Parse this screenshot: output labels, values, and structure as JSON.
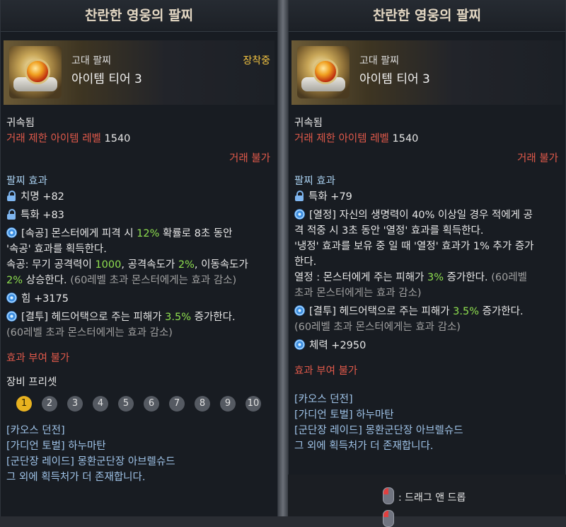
{
  "left": {
    "title": "찬란한 영웅의 팔찌",
    "grade": "고대 팔찌",
    "tier": "아이템 티어 3",
    "equipped": "장착중",
    "bound": "귀속됨",
    "level_label": "거래 제한 아이템 레벨",
    "level_value": "1540",
    "trade": "거래 불가",
    "effect_header": "팔찌 효과",
    "stat1": "치명 +82",
    "stat2": "특화 +83",
    "e1a": "[속공] 몬스터에게 피격 시 ",
    "e1b": "12%",
    "e1c": " 확률로 8초 동안",
    "e1d": "'속공' 효과를 획득한다.",
    "e2a": "속공: 무기 공격력이 ",
    "e2b": "1000",
    "e2c": ", 공격속도가 ",
    "e2d": "2%",
    "e2e": ", 이동속도가",
    "e2f": "2%",
    "e2g": " 상승한다. ",
    "e2h": "(60레벨 초과 몬스터에게는 효과 감소)",
    "stat3": "힘 +3175",
    "e3a": "[결투] 헤드어택으로 주는 피해가 ",
    "e3b": "3.5%",
    "e3c": " 증가한다.",
    "e3d": "(60레벨 초과 몬스터에게는 효과 감소)",
    "no_grant": "효과 부여 불가",
    "preset_label": "장비 프리셋",
    "presets": [
      "1",
      "2",
      "3",
      "4",
      "5",
      "6",
      "7",
      "8",
      "9",
      "10"
    ],
    "src1": "[카오스 던전]",
    "src2": "[가디언 토벌] 하누마탄",
    "src3": "[군단장 레이드] 몽환군단장 아브렐슈드",
    "src4": "그 외에 획득처가 더 존재합니다."
  },
  "right": {
    "title": "찬란한 영웅의 팔찌",
    "grade": "고대 팔찌",
    "tier": "아이템 티어 3",
    "bound": "귀속됨",
    "level_label": "거래 제한 아이템 레벨",
    "level_value": "1540",
    "trade": "거래 불가",
    "effect_header": "팔찌 효과",
    "stat1": "특화 +79",
    "e1a": "[열정] 자신의 생명력이 40% 이상일 경우 적에게 공",
    "e1b": "격 적중 시 3초 동안 '열정' 효과를 획득한다.",
    "e1c": "'냉정' 효과를 보유 중 일 때 '열정' 효과가 1% 추가 증가",
    "e1d": "한다.",
    "e2a": "열정 : 몬스터에게 주는 피해가 ",
    "e2b": "3%",
    "e2c": " 증가한다. ",
    "e2d": "(60레벨",
    "e2e": "초과 몬스터에게는 효과 감소)",
    "e3a": "[결투] 헤드어택으로 주는 피해가 ",
    "e3b": "3.5%",
    "e3c": " 증가한다.",
    "e3d": "(60레벨 초과 몬스터에게는 효과 감소)",
    "stat2": "체력 +2950",
    "no_grant": "효과 부여 불가",
    "src1": "[카오스 던전]",
    "src2": "[가디언 토벌] 하누마탄",
    "src3": "[군단장 레이드] 몽환군단장 아브렐슈드",
    "src4": "그 외에 획득처가 더 존재합니다.",
    "hint1": ": 드래그 앤 드롭"
  }
}
